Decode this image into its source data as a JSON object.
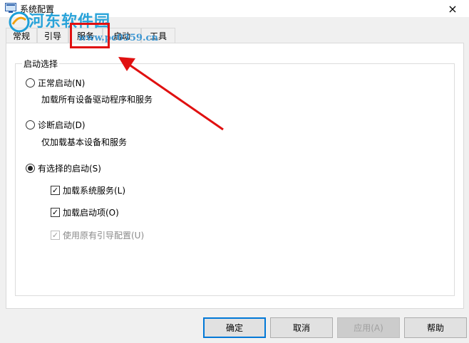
{
  "window": {
    "title": "系统配置",
    "close_icon": "×"
  },
  "watermark": {
    "text": "河东软件园",
    "sub": "www.pc0359.cn"
  },
  "tabs": [
    {
      "label": "常规"
    },
    {
      "label": "引导"
    },
    {
      "label": "服务"
    },
    {
      "label": "启动"
    },
    {
      "label": "工具"
    }
  ],
  "startup_group": {
    "legend": "启动选择",
    "normal": {
      "label": "正常启动(N)",
      "desc": "加载所有设备驱动程序和服务",
      "checked": false
    },
    "diagnostic": {
      "label": "诊断启动(D)",
      "desc": "仅加载基本设备和服务",
      "checked": false
    },
    "selective": {
      "label": "有选择的启动(S)",
      "checked": true,
      "options": [
        {
          "label": "加载系统服务(L)",
          "checked": true,
          "enabled": true
        },
        {
          "label": "加载启动项(O)",
          "checked": true,
          "enabled": true
        },
        {
          "label": "使用原有引导配置(U)",
          "checked": true,
          "enabled": false
        }
      ]
    }
  },
  "buttons": {
    "ok": "确定",
    "cancel": "取消",
    "apply": "应用(A)",
    "help": "帮助"
  },
  "colors": {
    "highlight": "#e01010",
    "accent": "#0078d7",
    "watermark": "#1e9fd8"
  }
}
